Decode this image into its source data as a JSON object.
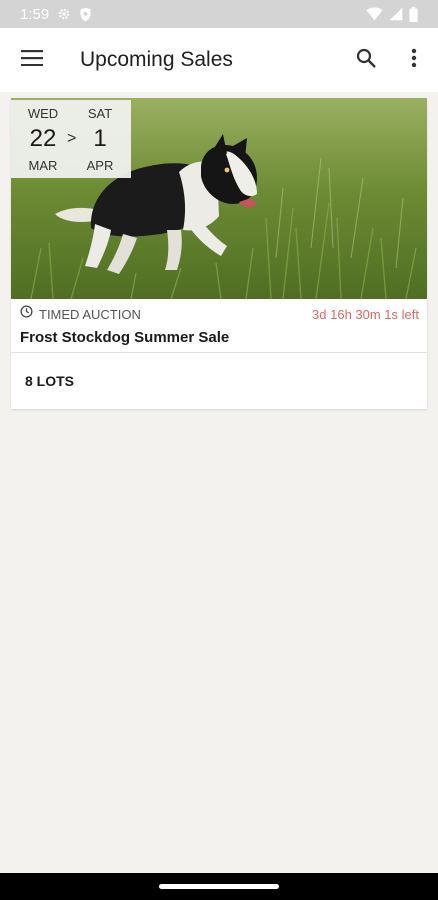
{
  "status_bar": {
    "time": "1:59",
    "icons": [
      "settings-icon",
      "shield-icon",
      "wifi-icon",
      "cell-signal-icon",
      "battery-icon"
    ]
  },
  "app_bar": {
    "title": "Upcoming Sales",
    "actions": [
      "menu-icon",
      "search-icon",
      "more-vert-icon"
    ]
  },
  "sales": [
    {
      "image": "border-collie-running-in-grass",
      "start": {
        "dow": "WED",
        "day": "22",
        "month": "MAR"
      },
      "arrow": ">",
      "end": {
        "dow": "SAT",
        "day": "1",
        "month": "APR"
      },
      "type": "TIMED AUCTION",
      "countdown": "3d 16h 30m 1s left",
      "title": "Frost Stockdog Summer Sale",
      "lots": "8 LOTS"
    }
  ],
  "colors": {
    "background": "#f3f2ef",
    "card": "#ffffff",
    "countdown": "#e06666",
    "status_bar": "#d4d4d4",
    "nav_bar": "#000000"
  }
}
